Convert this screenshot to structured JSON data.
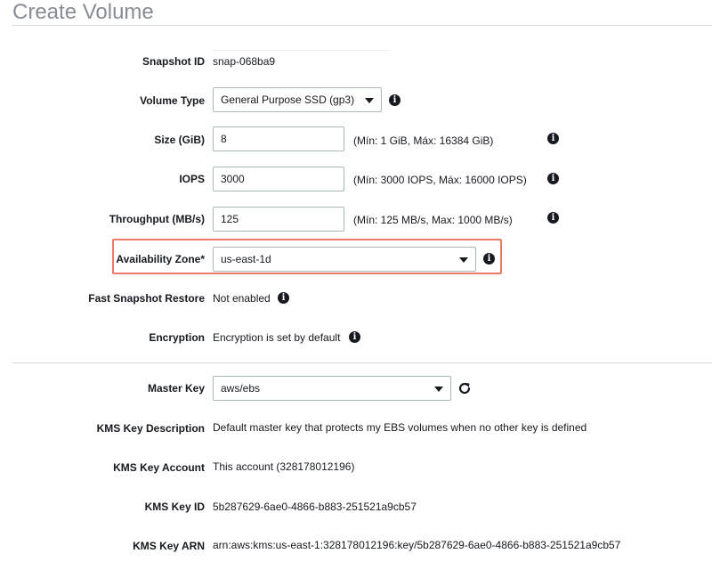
{
  "page": {
    "title": "Create Volume"
  },
  "snapshot": {
    "label": "Snapshot ID",
    "value": "snap-068ba9"
  },
  "volume_type": {
    "label": "Volume Type",
    "value": "General Purpose SSD (gp3)"
  },
  "size": {
    "label": "Size (GiB)",
    "value": "8",
    "hint": "(Mín: 1 GiB, Máx: 16384 GiB)"
  },
  "iops": {
    "label": "IOPS",
    "value": "3000",
    "hint": "(Mín: 3000 IOPS, Máx: 16000 IOPS)"
  },
  "throughput": {
    "label": "Throughput (MB/s)",
    "value": "125",
    "hint": "(Mín: 125 MB/s, Max: 1000 MB/s)"
  },
  "availability_zone": {
    "label": "Availability Zone*",
    "value": "us-east-1d",
    "highlight_color": "#ec7a6b"
  },
  "fast_snapshot_restore": {
    "label": "Fast Snapshot Restore",
    "value": "Not enabled"
  },
  "encryption": {
    "label": "Encryption",
    "value": "Encryption is set by default"
  },
  "master_key": {
    "label": "Master Key",
    "value": "aws/ebs"
  },
  "kms_description": {
    "label": "KMS Key Description",
    "value": "Default master key that protects my EBS volumes when no other key is defined"
  },
  "kms_account": {
    "label": "KMS Key Account",
    "value": "This account (328178012196)"
  },
  "kms_key_id": {
    "label": "KMS Key ID",
    "value": "5b287629-6ae0-4866-b883-251521a9cb57"
  },
  "kms_key_arn": {
    "label": "KMS Key ARN",
    "value": "arn:aws:kms:us-east-1:328178012196:key/5b287629-6ae0-4866-b883-251521a9cb57"
  },
  "icons": {
    "info": "info-icon",
    "caret": "chevron-down-icon",
    "refresh": "refresh-icon"
  }
}
